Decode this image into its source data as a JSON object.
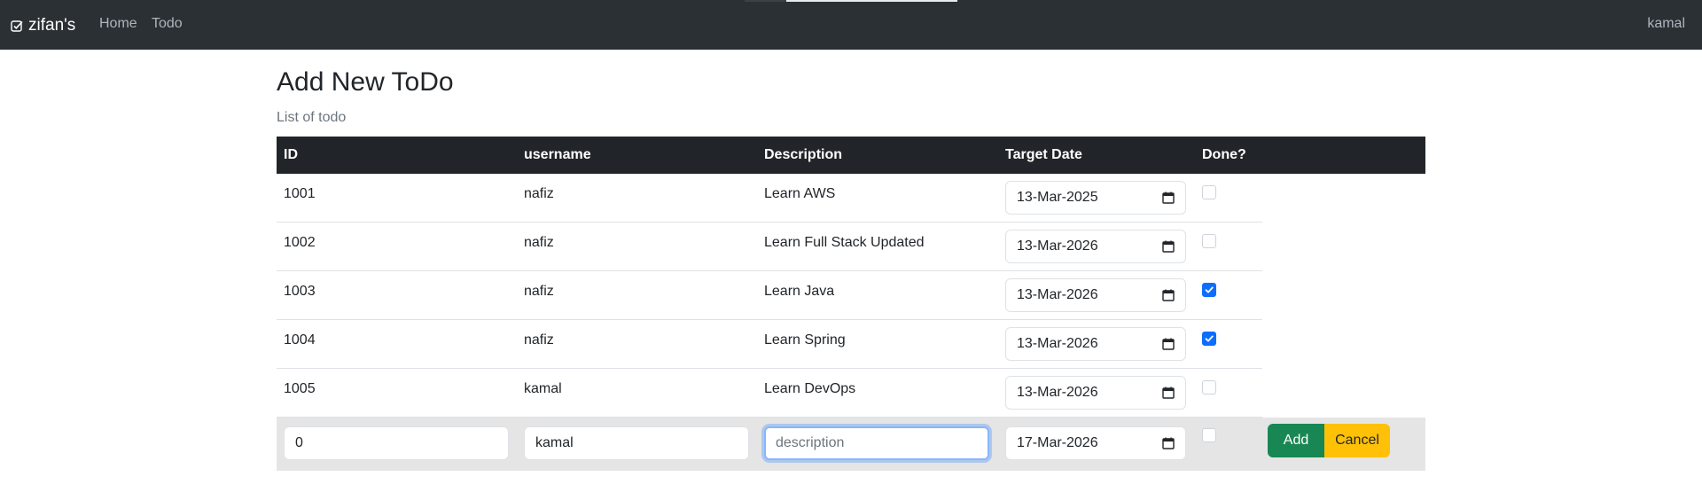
{
  "navbar": {
    "brand": "zifan's",
    "links": [
      "Home",
      "Todo"
    ],
    "user": "kamal"
  },
  "page": {
    "title": "Add New ToDo",
    "caption": "List of todo"
  },
  "table": {
    "columns": [
      "ID",
      "username",
      "Description",
      "Target Date",
      "Done?"
    ],
    "rows": [
      {
        "id": "1001",
        "username": "nafiz",
        "description": "Learn AWS",
        "target_date": "13-Mar-2025",
        "done": false
      },
      {
        "id": "1002",
        "username": "nafiz",
        "description": "Learn Full Stack Updated",
        "target_date": "13-Mar-2026",
        "done": false
      },
      {
        "id": "1003",
        "username": "nafiz",
        "description": "Learn Java",
        "target_date": "13-Mar-2026",
        "done": true
      },
      {
        "id": "1004",
        "username": "nafiz",
        "description": "Learn Spring",
        "target_date": "13-Mar-2026",
        "done": true
      },
      {
        "id": "1005",
        "username": "kamal",
        "description": "Learn DevOps",
        "target_date": "13-Mar-2026",
        "done": false
      }
    ]
  },
  "form": {
    "id_value": "0",
    "username_value": "kamal",
    "description_placeholder": "description",
    "target_date_value": "17-Mar-2026",
    "done": false,
    "add_label": "Add",
    "cancel_label": "Cancel"
  },
  "colors": {
    "navbar": "#2b3035",
    "table_header": "#212529",
    "add_button": "#198754",
    "cancel_button": "#ffc107",
    "checkbox_checked": "#0d6efd"
  }
}
